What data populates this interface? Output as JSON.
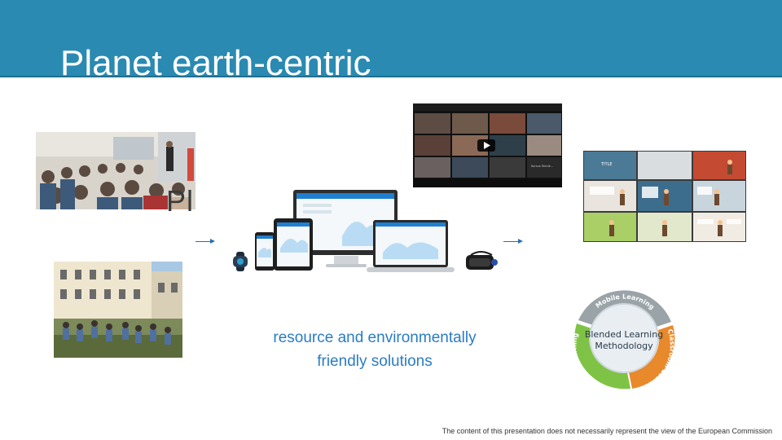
{
  "slide": {
    "title": "Planet earth-centric",
    "ghost_text": "Pl",
    "caption_line1": "resource and environmentally",
    "caption_line2": "friendly solutions",
    "footer": "The content of this presentation does not necessarily represent the view of the European Commission"
  },
  "video_call": {
    "bottom_label": "Kursus Teknik..."
  },
  "course_grid": {
    "tile_heading": "TITLE"
  },
  "diagram": {
    "center_line1": "Blended Learning",
    "center_line2": "Methodology",
    "segment_top": "Mobile Learning",
    "segment_right": "Classroom Learning",
    "segment_left": "Online Learning"
  },
  "colors": {
    "header": "#2a8ab1",
    "caption": "#2a7cc4",
    "diagram_green": "#7fc346",
    "diagram_orange": "#e8892b",
    "diagram_gray": "#9aa3a8"
  }
}
